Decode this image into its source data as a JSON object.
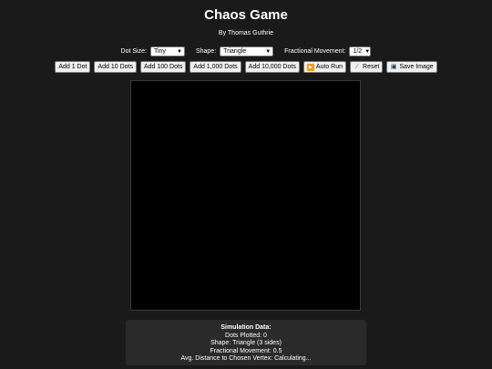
{
  "app": {
    "title": "Chaos Game",
    "author": "By Thomas Guthrie"
  },
  "controls": {
    "dot_size_label": "Dot Size:",
    "dot_size_value": "Tiny",
    "shape_label": "Shape:",
    "shape_value": "Triangle",
    "fraction_label": "Fractional Movement:",
    "fraction_value": "1/2"
  },
  "buttons": {
    "add_1": "Add 1 Dot",
    "add_10": "Add 10 Dots",
    "add_100": "Add 100 Dots",
    "add_1000": "Add 1,000 Dots",
    "add_10000": "Add 10,000 Dots",
    "auto_run": "Auto Run",
    "reset": "Reset",
    "save_image": "Save Image"
  },
  "icons": {
    "auto_run": "play-icon",
    "reset": "broom-icon",
    "save_image": "floppy-disk-icon",
    "dropdown": "chevron-down-icon"
  },
  "simulation": {
    "heading": "Simulation Data:",
    "dots_plotted": "Dots Plotted: 0",
    "shape": "Shape: Triangle (3 sides)",
    "fractional_movement": "Fractional Movement: 0.5",
    "avg_distance": "Avg. Distance to Chosen Vertex: Calculating..."
  },
  "colors": {
    "background": "#1a1a1a",
    "canvas": "#000000",
    "panel": "#2a2a2a",
    "text": "#ffffff",
    "auto_run_icon": "#f39c12"
  }
}
